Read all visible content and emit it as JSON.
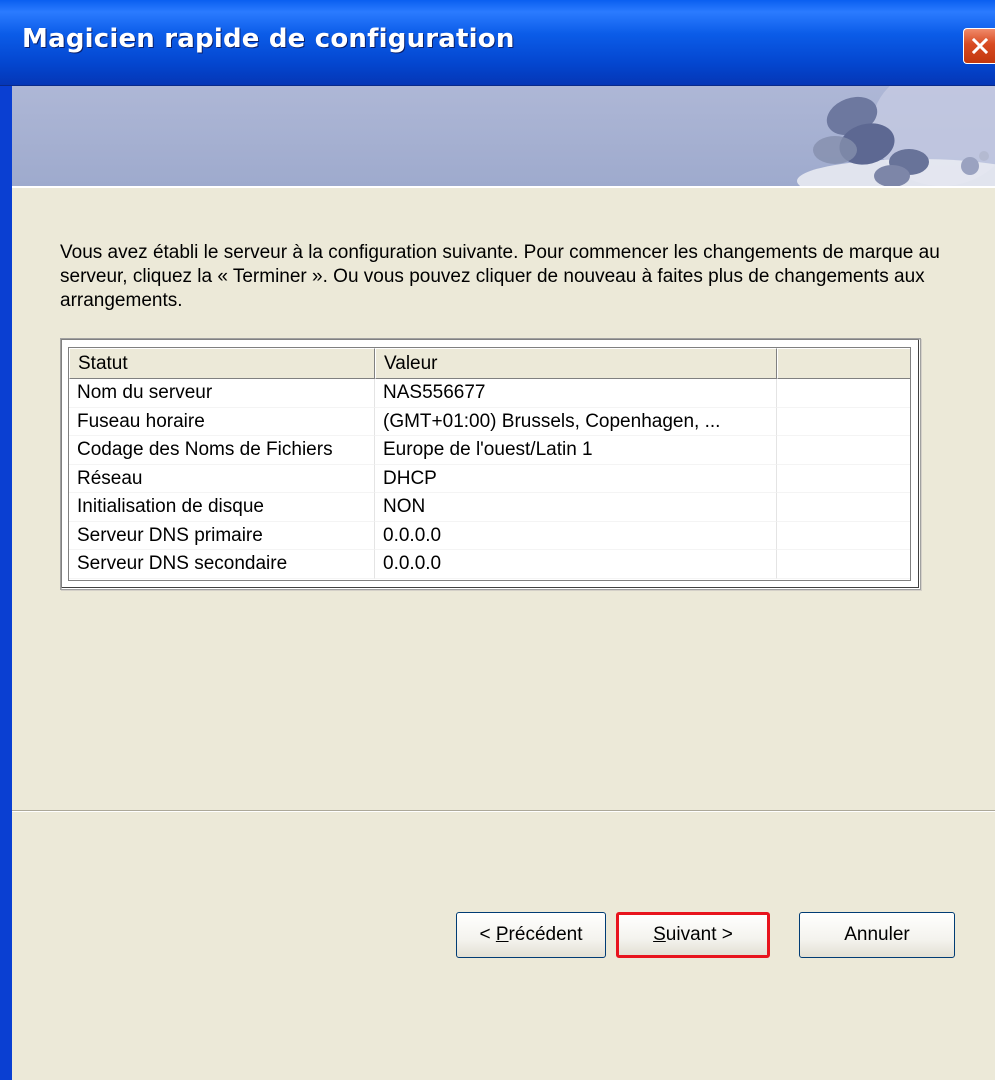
{
  "window": {
    "title": "Magicien rapide de configuration",
    "title_bar_color": "#0a5ce8",
    "close_icon": "close-icon"
  },
  "intro_text": "Vous avez établi le serveur à la configuration suivante.  Pour commencer les changements de marque au serveur, cliquez la « Terminer ». Ou vous pouvez cliquer de nouveau à faites plus de changements aux arrangements.",
  "table": {
    "headers": [
      "Statut",
      "Valeur",
      ""
    ],
    "rows": [
      [
        "Nom du serveur",
        "NAS556677"
      ],
      [
        "Fuseau horaire",
        "(GMT+01:00) Brussels, Copenhagen, ..."
      ],
      [
        "Codage des Noms de Fichiers",
        "Europe de l'ouest/Latin 1"
      ],
      [
        "Réseau",
        "DHCP"
      ],
      [
        "Initialisation de disque",
        "NON"
      ],
      [
        "Serveur DNS primaire",
        "0.0.0.0"
      ],
      [
        "Serveur DNS secondaire",
        "0.0.0.0"
      ]
    ]
  },
  "buttons": {
    "prev_prefix": "< ",
    "prev_mnemonic": "P",
    "prev_rest": "récédent",
    "next_mnemonic": "S",
    "next_rest": "uivant >",
    "cancel": "Annuler"
  },
  "colors": {
    "highlight_border": "#e8141d",
    "dialog_background": "#ece9d8"
  }
}
